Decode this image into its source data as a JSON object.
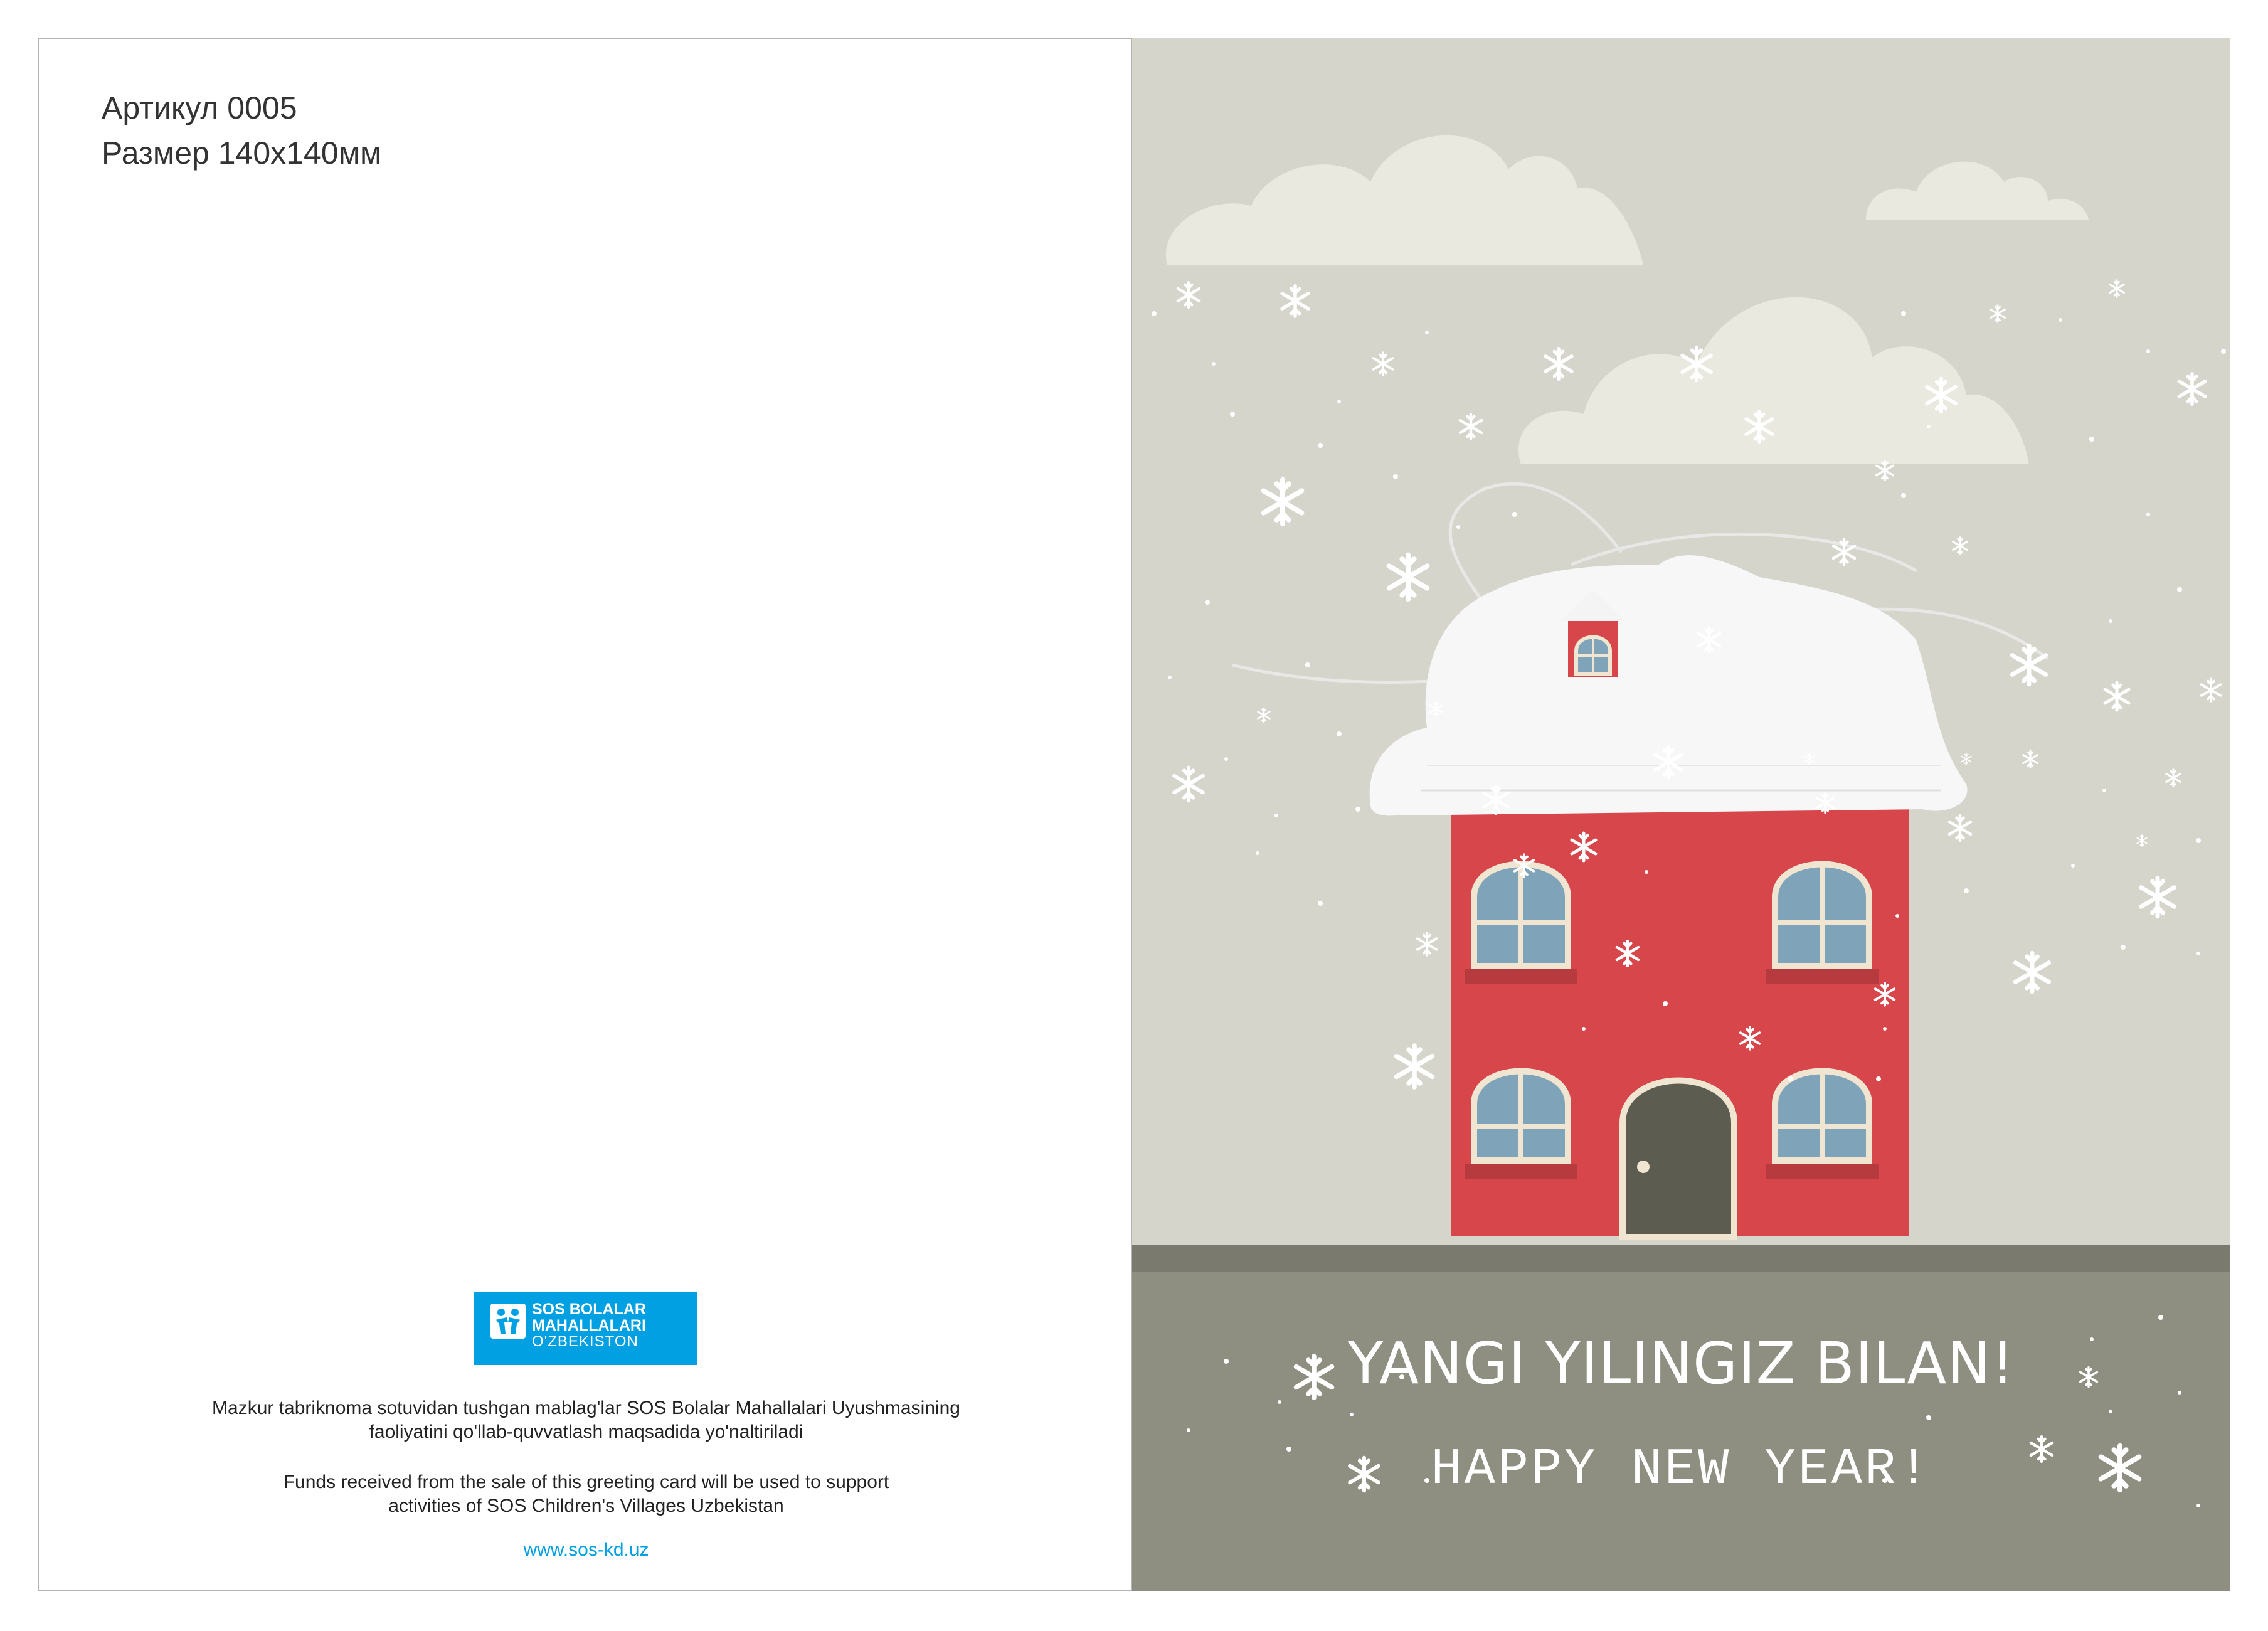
{
  "back": {
    "article_line": "Артикул 0005",
    "size_line": "Размер 140х140мм",
    "logo": {
      "line1": "SOS BOLALAR",
      "line2": "MAHALLALARI",
      "line3": "O'ZBEKISTON",
      "color": "#00a0e3"
    },
    "text_uz_1": "Mazkur tabriknoma sotuvidan tushgan mablag'lar SOS Bolalar Mahallalari Uyushmasining",
    "text_uz_2": "faoliyatini qo'llab-quvvatlash maqsadida yo'naltiriladi",
    "text_en_1": "Funds received from the sale of this greeting card will be used to support",
    "text_en_2": "activities of SOS Children's Villages Uzbekistan",
    "url": "www.sos-kd.uz"
  },
  "front": {
    "greeting_uz": "YANGI YILINGIZ BILAN!",
    "greeting_en": "HAPPY NEW YEAR!",
    "colors": {
      "sky": "#d5d5cb",
      "ground": "#8f8f81",
      "ground_top": "#7a7a6e",
      "house": "#d6464b",
      "roof_snow": "#f7f7f7",
      "window": "#7fa3b8",
      "door": "#5c5c50"
    }
  }
}
